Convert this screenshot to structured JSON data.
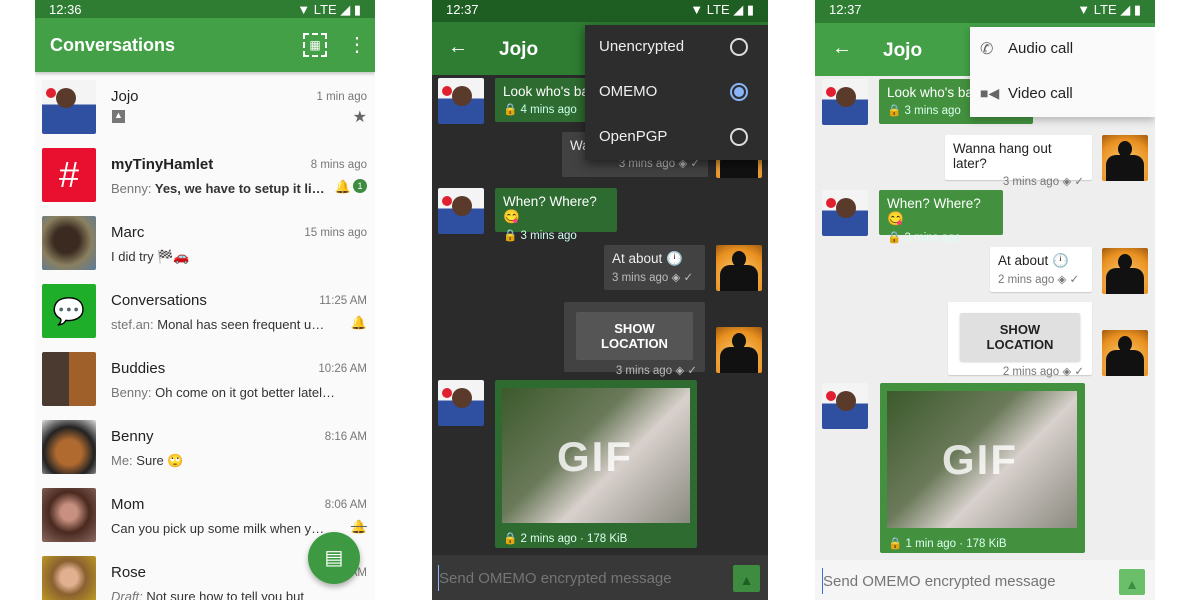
{
  "colors": {
    "primary": "#43a047",
    "primary_dark": "#2e7d32",
    "accent": "#8ab4f8",
    "unread": "#3d8c40"
  },
  "list": {
    "status_time": "12:36",
    "status_net": "LTE",
    "title": "Conversations",
    "items": [
      {
        "name": "Jojo",
        "time": "1 min ago",
        "preview": "",
        "icons": [
          "image-icon",
          "star-icon"
        ]
      },
      {
        "name": "myTinyHamlet",
        "time": "8 mins ago",
        "sender": "Benny:",
        "preview": "Yes, we have to setup it lik…",
        "unread": "1",
        "avatar_text": "#"
      },
      {
        "name": "Marc",
        "time": "15 mins ago",
        "preview": "I did try 🏁🚗"
      },
      {
        "name": "Conversations",
        "time": "11:25 AM",
        "sender": "stef.an:",
        "preview": "Monal has seen frequent upda…"
      },
      {
        "name": "Buddies",
        "time": "10:26 AM",
        "sender": "Benny:",
        "preview": "Oh come on it got better lately 🤓"
      },
      {
        "name": "Benny",
        "time": "8:16 AM",
        "sender": "Me:",
        "preview": "Sure 🙄"
      },
      {
        "name": "Mom",
        "time": "8:06 AM",
        "preview": "Can you pick up some milk when you c…"
      },
      {
        "name": "Rose",
        "time": "AM",
        "sender": "Draft:",
        "preview": "Not sure how to tell you but"
      }
    ]
  },
  "chat_dark": {
    "status_time": "12:37",
    "status_net": "LTE",
    "title": "Jojo",
    "menu": [
      {
        "label": "Unencrypted",
        "selected": false
      },
      {
        "label": "OMEMO",
        "selected": true
      },
      {
        "label": "OpenPGP",
        "selected": false
      }
    ],
    "m1": {
      "text": "Look who's ba",
      "time": "4 mins ago"
    },
    "m2": {
      "text": "Wa",
      "time": "3 mins ago"
    },
    "m3": {
      "text": "When? Where? 😋",
      "time": "3 mins ago"
    },
    "m4": {
      "text": "At about 🕛",
      "time": "3 mins ago"
    },
    "m5": {
      "button": "SHOW LOCATION",
      "time": "3 mins ago"
    },
    "m6": {
      "gif_label": "GIF",
      "time": "2 mins ago · 178 KiB"
    },
    "input_placeholder": "Send OMEMO encrypted message"
  },
  "chat_light": {
    "status_time": "12:37",
    "status_net": "LTE",
    "title": "Jojo",
    "menu": [
      {
        "label": "Audio call",
        "icon": "phone-icon"
      },
      {
        "label": "Video call",
        "icon": "videocam-icon"
      }
    ],
    "m1": {
      "text": "Look who's ba",
      "time": "3 mins ago"
    },
    "m2": {
      "text": "Wanna hang out later?",
      "time": "3 mins ago"
    },
    "m3": {
      "text": "When? Where? 😋",
      "time": "3 mins ago"
    },
    "m4": {
      "text": "At about 🕛",
      "time": "2 mins ago"
    },
    "m5": {
      "button": "SHOW LOCATION",
      "time": "2 mins ago"
    },
    "m6": {
      "gif_label": "GIF",
      "time": "1 min ago · 178 KiB"
    },
    "input_placeholder": "Send OMEMO encrypted message"
  }
}
